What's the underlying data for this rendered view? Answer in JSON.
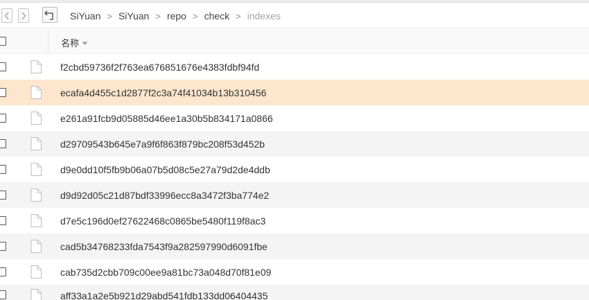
{
  "breadcrumb": {
    "items": [
      "SiYuan",
      "SiYuan",
      "repo",
      "check",
      "indexes"
    ],
    "separator": ">"
  },
  "table": {
    "column_name": "名称",
    "rows": [
      "f2cbd59736f2f763ea676851676e4383fdbf94fd",
      "ecafa4d455c1d2877f2c3a74f41034b13b310456",
      "e261a91fcb9d05885d46ee1a30b5b834171a0866",
      "d29709543b645e7a9f6f863f879bc208f53d452b",
      "d9e0dd10f5fb9b06a07b5d08c5e27a79d2de4ddb",
      "d9d92d05c21d87bdf33996ecc8a3472f3ba774e2",
      "d7e5c196d0ef27622468c0865be5480f119f8ac3",
      "cad5b34768233fda7543f9a282597990d6091fbe",
      "cab735d2cbb709c00ee9a81bc73a048d70f81e09",
      "aff33a1a2e5b921d29abd541fdb133dd06404435"
    ],
    "selected_index": 1
  },
  "colors": {
    "selected_row": "#fde6cd",
    "stripe_row": "#f4f4f4"
  },
  "icons": {
    "back": "chevron-left-icon",
    "forward": "chevron-right-icon",
    "up": "up-folder-icon",
    "file": "file-icon",
    "sort": "caret-down-icon"
  }
}
